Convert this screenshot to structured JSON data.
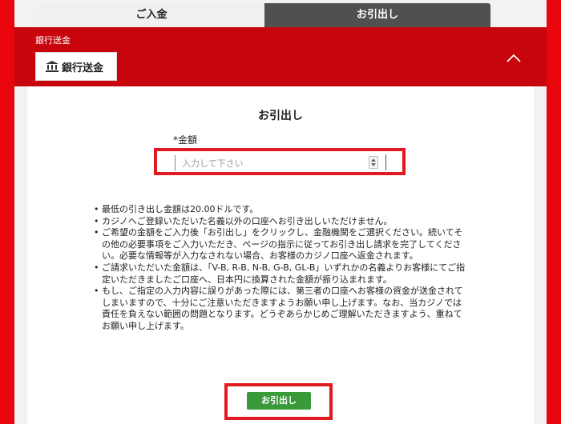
{
  "tabs": [
    {
      "label": "ご入金"
    },
    {
      "label": "お引出し"
    }
  ],
  "bank_section": {
    "header_label": "銀行送金",
    "method_label": "銀行送金"
  },
  "form": {
    "title": "お引出し",
    "amount_label": "*金額",
    "amount_placeholder": "入力して下さい",
    "submit_label": "お引出し"
  },
  "notes": [
    "最低の引き出し金額は20.00ドルです。",
    "カジノへご登録いただいた名義以外の口座へお引き出しいただけません。",
    "ご希望の金額をご入力後「お引出し」をクリックし、金融機関をご選択ください。続いてその他の必要事項をご入力いただき、ページの指示に従ってお引き出し請求を完了してください。必要な情報等が入力なされない場合、お客様のカジノ口座へ返金されます。",
    "ご請求いただいた金額は、「V-B, R-B, N-B, G-B, GL-B」いずれかの名義よりお客様にてご指定いただきましたご口座へ、日本円に換算された金額が振り込まれます。",
    "もし、ご指定の入力内容に誤りがあった際には、第三者の口座へお客様の資金が送金されてしまいますので、十分にご注意いただきますようお願い申し上げます。なお、当カジノでは責任を負えない範囲の問題となります。どうぞあらかじめご理解いただきますよう、重ねてお願い申し上げます。"
  ],
  "colors": {
    "frame_red": "#e8050b",
    "header_red": "#c8050c",
    "highlight_red": "#e31920",
    "active_tab": "#505050",
    "button_green": "#3a9a3a"
  },
  "icons": {
    "bank": "bank-icon",
    "collapse": "chevron-up-icon",
    "spinner": "number-spinner-icon"
  }
}
